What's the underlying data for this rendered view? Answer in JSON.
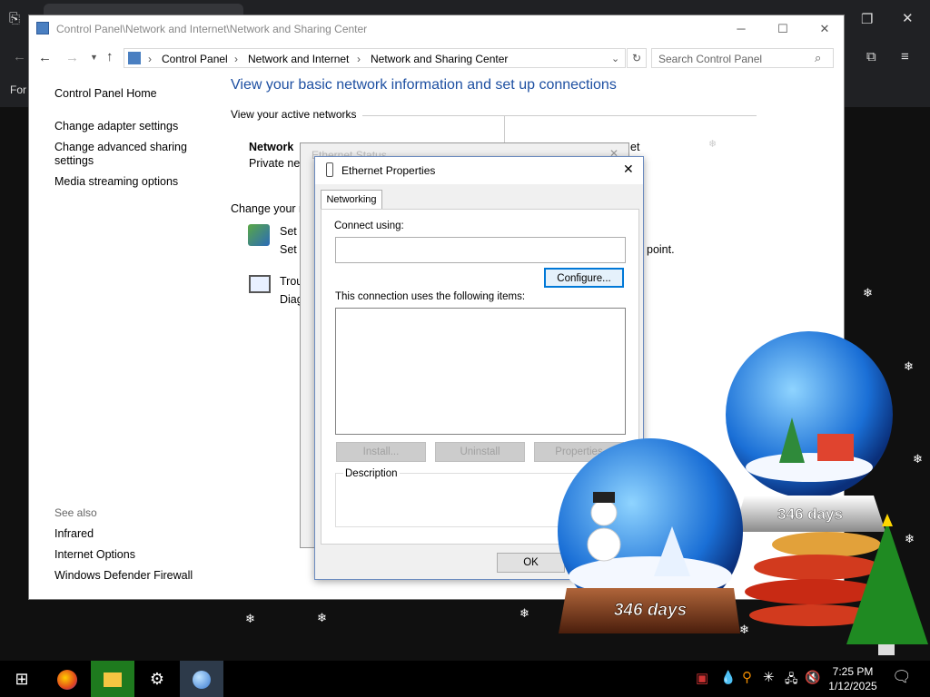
{
  "background_browser": {
    "partial_text": "For"
  },
  "window": {
    "title": "Control Panel\\Network and Internet\\Network and Sharing Center",
    "breadcrumbs": [
      "Control Panel",
      "Network and Internet",
      "Network and Sharing Center"
    ],
    "search_placeholder": "Search Control Panel"
  },
  "sidebar": {
    "home": "Control Panel Home",
    "links": [
      "Change adapter settings",
      "Change advanced sharing",
      "settings",
      "Media streaming options"
    ],
    "see_also_label": "See also",
    "see_also": [
      "Infrared",
      "Internet Options",
      "Windows Defender Firewall"
    ]
  },
  "main": {
    "heading": "View your basic network information and set up connections",
    "active_networks_label": "View your active networks",
    "network_name": "Network",
    "network_type": "Private net",
    "right_fragment": "et",
    "change_label": "Change your n",
    "setup_link": "Set u",
    "setup_desc": "Set u",
    "setup_desc_tail": "point.",
    "troubleshoot_link": "Trou",
    "troubleshoot_desc": "Diag"
  },
  "ethernet_status": {
    "title": "Ethernet Status"
  },
  "ethernet_properties": {
    "title": "Ethernet Properties",
    "tab": "Networking",
    "connect_using_label": "Connect using:",
    "connect_using_value": "",
    "configure_button": "Configure...",
    "items_label": "This connection uses the following items:",
    "install_button": "Install...",
    "uninstall_button": "Uninstall",
    "properties_button": "Properties",
    "description_label": "Description",
    "ok_button": "OK"
  },
  "snowglobes": {
    "left_counter": "346 days",
    "right_counter": "346 days"
  },
  "taskbar": {
    "time": "7:25 PM",
    "date": "1/12/2025"
  }
}
